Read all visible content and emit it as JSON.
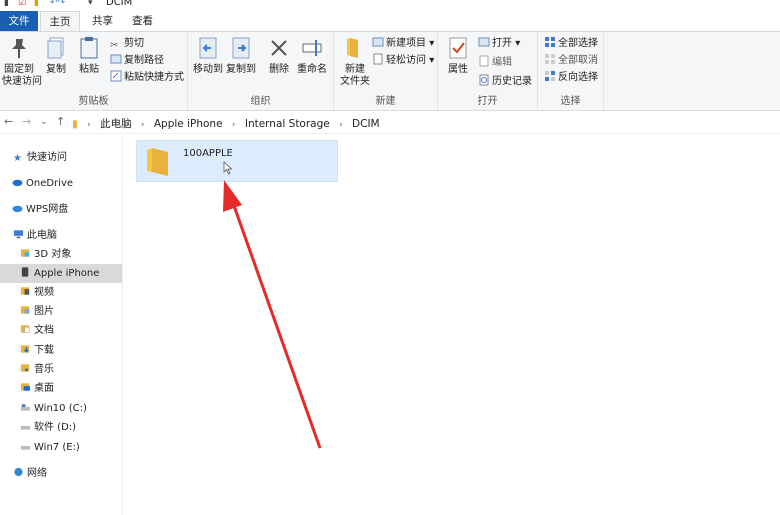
{
  "window": {
    "title": "DCIM"
  },
  "tabs": {
    "file": "文件",
    "home": "主页",
    "share": "共享",
    "view": "查看"
  },
  "ribbon": {
    "clipboard": {
      "label": "剪贴板",
      "pin_line1": "固定到",
      "pin_line2": "快速访问",
      "copy": "复制",
      "paste": "粘贴",
      "cut": "剪切",
      "copy_path": "复制路径",
      "paste_shortcut": "粘贴快捷方式"
    },
    "organize": {
      "label": "组织",
      "move_to": "移动到",
      "copy_to": "复制到",
      "delete": "删除",
      "rename": "重命名"
    },
    "new": {
      "label": "新建",
      "new_folder_line1": "新建",
      "new_folder_line2": "文件夹",
      "new_item": "新建项目",
      "easy_access": "轻松访问"
    },
    "open": {
      "label": "打开",
      "properties": "属性",
      "open": "打开",
      "edit": "编辑",
      "history": "历史记录"
    },
    "select": {
      "label": "选择",
      "select_all": "全部选择",
      "select_none": "全部取消",
      "invert": "反向选择"
    }
  },
  "address": {
    "crumbs": [
      "此电脑",
      "Apple iPhone",
      "Internal Storage",
      "DCIM"
    ]
  },
  "sidebar": {
    "items": [
      {
        "label": "快速访问",
        "icon": "star-icon"
      },
      {
        "label": "OneDrive",
        "icon": "cloud-icon"
      },
      {
        "label": "WPS网盘",
        "icon": "cloud-icon"
      },
      {
        "label": "此电脑",
        "icon": "computer-icon"
      },
      {
        "label": "3D 对象",
        "icon": "cube-folder-icon"
      },
      {
        "label": "Apple iPhone",
        "icon": "phone-icon"
      },
      {
        "label": "视频",
        "icon": "video-folder-icon"
      },
      {
        "label": "图片",
        "icon": "picture-folder-icon"
      },
      {
        "label": "文档",
        "icon": "document-folder-icon"
      },
      {
        "label": "下载",
        "icon": "download-folder-icon"
      },
      {
        "label": "音乐",
        "icon": "music-folder-icon"
      },
      {
        "label": "桌面",
        "icon": "desktop-folder-icon"
      },
      {
        "label": "Win10 (C:)",
        "icon": "drive-icon"
      },
      {
        "label": "软件 (D:)",
        "icon": "drive-icon"
      },
      {
        "label": "Win7 (E:)",
        "icon": "drive-icon"
      },
      {
        "label": "网络",
        "icon": "network-icon"
      }
    ]
  },
  "content": {
    "folders": [
      {
        "name": "100APPLE"
      }
    ]
  },
  "colors": {
    "file_tab": "#1a5fb4",
    "selection": "#dcecfc",
    "annotation_arrow": "#e52a2a",
    "folder": "#f2c14e"
  }
}
